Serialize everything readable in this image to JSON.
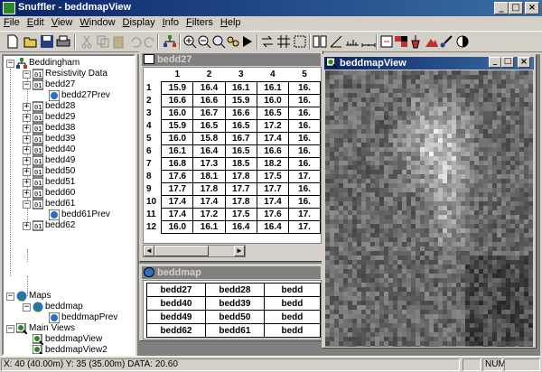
{
  "app": {
    "title": "Snuffler - beddmapView"
  },
  "menu": [
    {
      "key": "F",
      "rest": "ile"
    },
    {
      "key": "E",
      "rest": "dit"
    },
    {
      "key": "V",
      "rest": "iew"
    },
    {
      "key": "W",
      "rest": "indow"
    },
    {
      "key": "D",
      "rest": "isplay"
    },
    {
      "key": "I",
      "rest": "nfo"
    },
    {
      "key": "F",
      "rest": "ilters"
    },
    {
      "key": "H",
      "rest": "elp"
    }
  ],
  "tree": {
    "root": "Beddingham",
    "resistivity": "Resistivity Data",
    "items": [
      "bedd27",
      "bedd27Prev",
      "bedd28",
      "bedd29",
      "bedd38",
      "bedd39",
      "bedd40",
      "bedd49",
      "bedd50",
      "bedd51",
      "bedd60",
      "bedd61",
      "bedd61Prev",
      "bedd62"
    ],
    "maps": "Maps",
    "beddmap": "beddmap",
    "beddmapPrev": "beddmapPrev",
    "mainviews": "Main Views",
    "view1": "beddmapView",
    "view2": "beddmapView2"
  },
  "bedd27": {
    "title": "bedd27",
    "cols": [
      "1",
      "2",
      "3",
      "4",
      "5"
    ],
    "rows": [
      {
        "n": "1",
        "v": [
          "15.9",
          "16.4",
          "16.1",
          "16.1",
          "16."
        ]
      },
      {
        "n": "2",
        "v": [
          "16.6",
          "16.6",
          "15.9",
          "16.0",
          "16."
        ]
      },
      {
        "n": "3",
        "v": [
          "16.0",
          "16.7",
          "16.6",
          "16.5",
          "16."
        ]
      },
      {
        "n": "4",
        "v": [
          "15.9",
          "16.5",
          "16.5",
          "17.2",
          "16."
        ]
      },
      {
        "n": "5",
        "v": [
          "16.0",
          "15.8",
          "16.7",
          "17.4",
          "16."
        ]
      },
      {
        "n": "6",
        "v": [
          "16.1",
          "16.4",
          "16.5",
          "16.6",
          "16."
        ]
      },
      {
        "n": "7",
        "v": [
          "16.8",
          "17.3",
          "18.5",
          "18.2",
          "16."
        ]
      },
      {
        "n": "8",
        "v": [
          "17.6",
          "18.1",
          "17.8",
          "17.5",
          "17."
        ]
      },
      {
        "n": "9",
        "v": [
          "17.7",
          "17.8",
          "17.7",
          "17.7",
          "16."
        ]
      },
      {
        "n": "10",
        "v": [
          "17.4",
          "17.4",
          "17.8",
          "17.4",
          "16."
        ]
      },
      {
        "n": "11",
        "v": [
          "17.4",
          "17.2",
          "17.5",
          "17.6",
          "17."
        ]
      },
      {
        "n": "12",
        "v": [
          "16.0",
          "16.1",
          "16.4",
          "16.4",
          "17."
        ]
      }
    ]
  },
  "beddmap": {
    "title": "beddmap",
    "rows": [
      [
        "bedd27",
        "bedd28",
        "bedd"
      ],
      [
        "bedd40",
        "bedd39",
        "bedd"
      ],
      [
        "bedd49",
        "bedd50",
        "bedd"
      ],
      [
        "bedd62",
        "bedd61",
        "bedd"
      ]
    ]
  },
  "mapview": {
    "title": "beddmapView"
  },
  "status": {
    "coords": "X: 40 (40.00m)  Y: 35 (35.00m)  DATA: 20.60",
    "num": "NUM"
  }
}
